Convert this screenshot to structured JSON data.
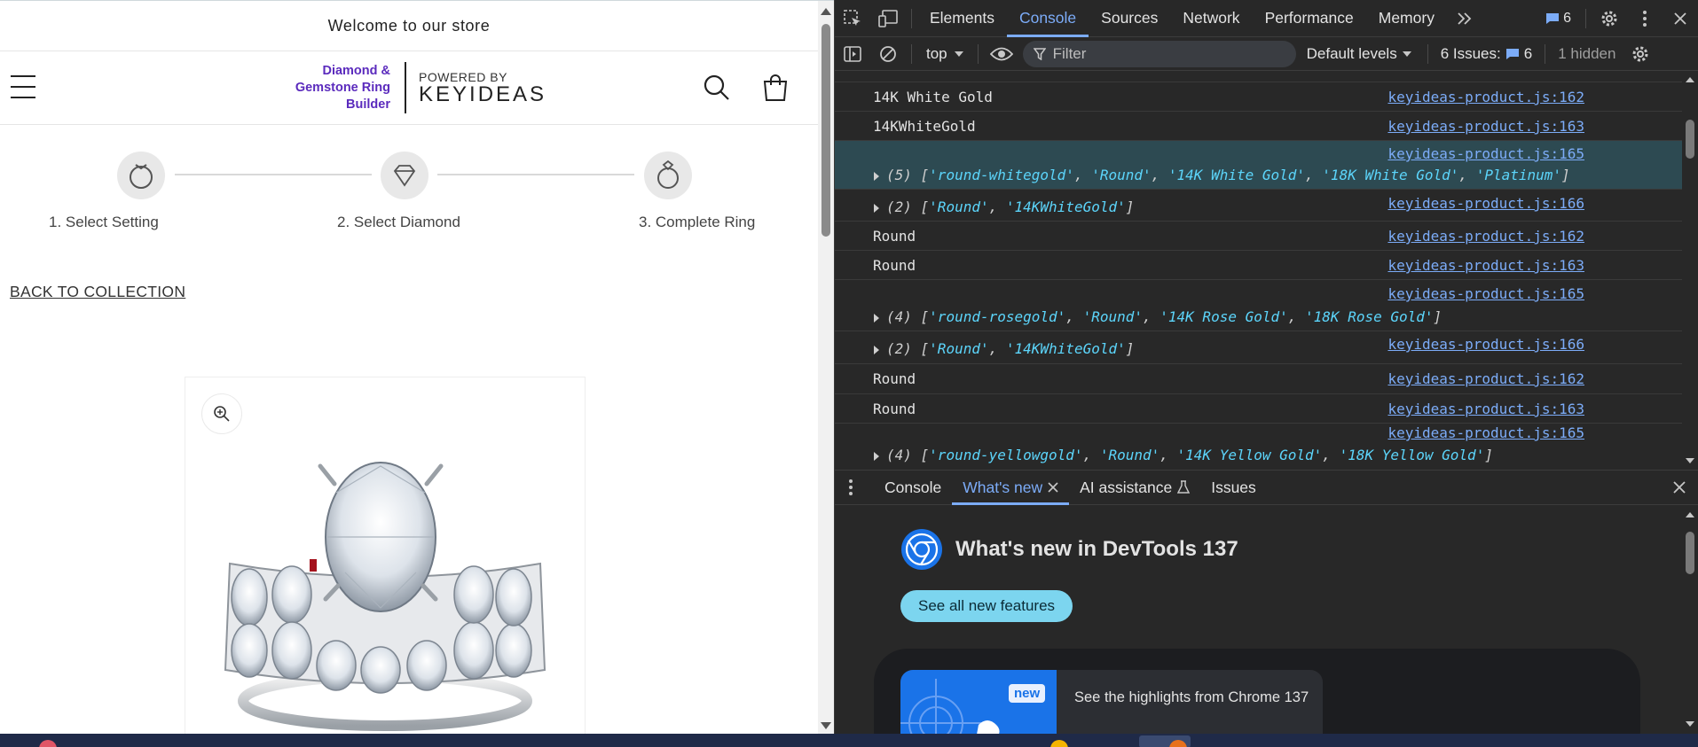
{
  "store": {
    "announcement": "Welcome to our store",
    "brand": {
      "line1": "Diamond &",
      "line2": "Gemstone Ring",
      "line3": "Builder",
      "powered_by": "POWERED BY",
      "company": "KEYIDEAS"
    },
    "steps": [
      {
        "label": "1. Select Setting"
      },
      {
        "label": "2. Select Diamond"
      },
      {
        "label": "3. Complete Ring"
      }
    ],
    "back_link": "BACK TO COLLECTION"
  },
  "devtools": {
    "tabs": [
      "Elements",
      "Console",
      "Sources",
      "Network",
      "Performance",
      "Memory"
    ],
    "active_tab": "Console",
    "message_count": "6",
    "context": "top",
    "filter_placeholder": "Filter",
    "levels": "Default levels",
    "issues_label": "6 Issues:",
    "issues_count": "6",
    "hidden": "1 hidden",
    "console_rows": [
      {
        "text": "14K White Gold",
        "link": "keyideas-product.js:162"
      },
      {
        "text": "14KWhiteGold",
        "link": "keyideas-product.js:163"
      },
      {
        "link": "keyideas-product.js:165",
        "count": "(5)",
        "items": [
          "'round-whitegold'",
          "'Round'",
          "'14K White Gold'",
          "'18K White Gold'",
          "'Platinum'"
        ]
      },
      {
        "link": "keyideas-product.js:166",
        "count": "(2)",
        "items": [
          "'Round'",
          "'14KWhiteGold'"
        ]
      },
      {
        "text": "Round",
        "link": "keyideas-product.js:162"
      },
      {
        "text": "Round",
        "link": "keyideas-product.js:163"
      },
      {
        "link": "keyideas-product.js:165",
        "count": "(4)",
        "items": [
          "'round-rosegold'",
          "'Round'",
          "'14K Rose Gold'",
          "'18K Rose Gold'"
        ]
      },
      {
        "link": "keyideas-product.js:166",
        "count": "(2)",
        "items": [
          "'Round'",
          "'14KWhiteGold'"
        ]
      },
      {
        "text": "Round",
        "link": "keyideas-product.js:162"
      },
      {
        "text": "Round",
        "link": "keyideas-product.js:163"
      },
      {
        "link": "keyideas-product.js:165",
        "count": "(4)",
        "items": [
          "'round-yellowgold'",
          "'Round'",
          "'14K Yellow Gold'",
          "'18K Yellow Gold'"
        ]
      }
    ],
    "drawer_tabs": [
      "Console",
      "What's new",
      "AI assistance",
      "Issues"
    ],
    "drawer_active": "What's new",
    "whats_new": {
      "title": "What's new in DevTools 137",
      "button": "See all new features",
      "badge": "new",
      "highlight": "See the highlights from Chrome 137"
    }
  },
  "colors": {
    "accent": "#7cacf8",
    "brand_purple": "#5b2bbd",
    "string_cyan": "#5cd5fb",
    "highlight_row": "#2d4a52"
  }
}
